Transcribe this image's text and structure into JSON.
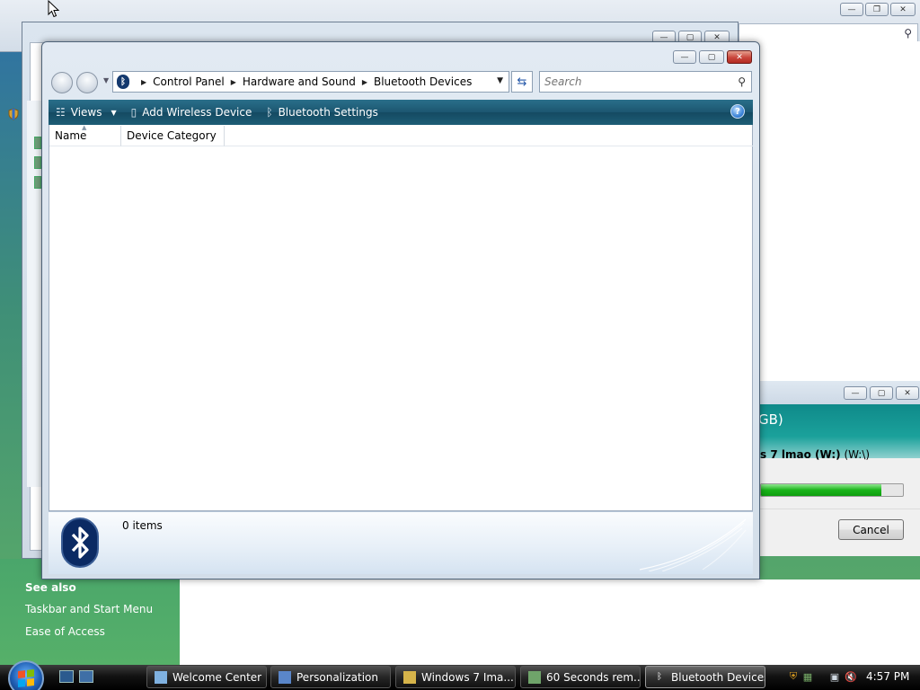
{
  "main_window": {
    "breadcrumb": [
      "Control Panel",
      "Hardware and Sound",
      "Bluetooth Devices"
    ],
    "search_placeholder": "Search",
    "toolbar": {
      "views": "Views",
      "add_wireless_device": "Add Wireless Device",
      "bluetooth_settings": "Bluetooth Settings"
    },
    "columns": [
      "Name",
      "Device Category"
    ],
    "status": "0 items"
  },
  "copy_window": {
    "header_fragment": "GB)",
    "destination_name": "s 7 lmao (W:)",
    "destination_path": "(W:\\)",
    "progress_percent": 85,
    "cancel": "Cancel"
  },
  "background_panel": {
    "see_also": "See also",
    "links": [
      "Taskbar and Start Menu",
      "Ease of Access"
    ]
  },
  "taskbar": {
    "buttons": [
      "Welcome Center",
      "Personalization",
      "Windows 7 Ima...",
      "60 Seconds rem...",
      "Bluetooth Devices"
    ],
    "clock": "4:57 PM"
  },
  "colors": {
    "command_bar": "#1c5670",
    "progress_fill": "#19b419",
    "bluetooth_blue": "#0b2a63"
  }
}
